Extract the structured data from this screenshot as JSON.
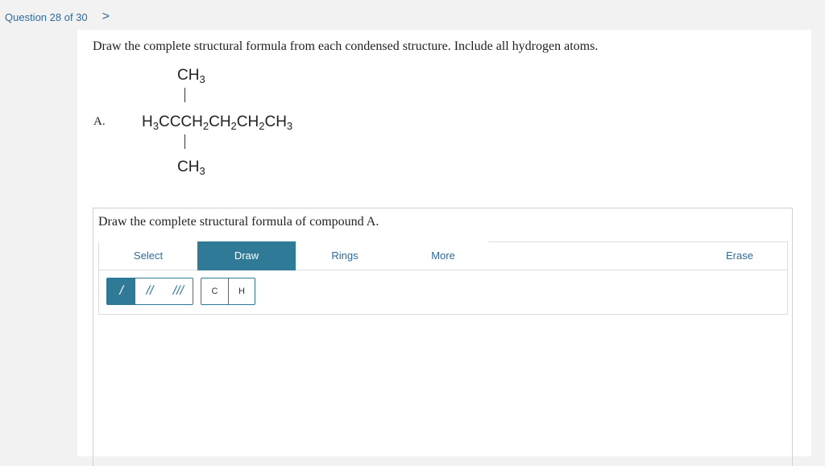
{
  "nav": {
    "question_label": "Question 28 of 30",
    "next_icon": "chevron-right-icon",
    "next_glyph": ">"
  },
  "question": {
    "prompt": "Draw the complete structural formula from each condensed structure. Include all hydrogen atoms.",
    "part_label": "A.",
    "structure": {
      "top_group": "CH",
      "top_sub": "3",
      "main_pre": "H",
      "main_sub1": "3",
      "main_mid1": "CCCH",
      "main_sub2": "2",
      "main_mid2": "CH",
      "main_sub3": "2",
      "main_mid3": "CH",
      "main_sub4": "2",
      "main_mid4": "CH",
      "main_sub5": "3",
      "bottom_group": "CH",
      "bottom_sub": "3"
    }
  },
  "drawing": {
    "title": "Draw the complete structural formula of compound A.",
    "tabs": {
      "select": "Select",
      "draw": "Draw",
      "rings": "Rings",
      "more": "More",
      "erase": "Erase"
    },
    "bond_tools": {
      "single": "/",
      "double": "//",
      "triple": "///"
    },
    "atom_tools": {
      "carbon": "C",
      "hydrogen": "H"
    }
  },
  "colors": {
    "accent": "#2f7a96",
    "link": "#2e6b9c"
  }
}
